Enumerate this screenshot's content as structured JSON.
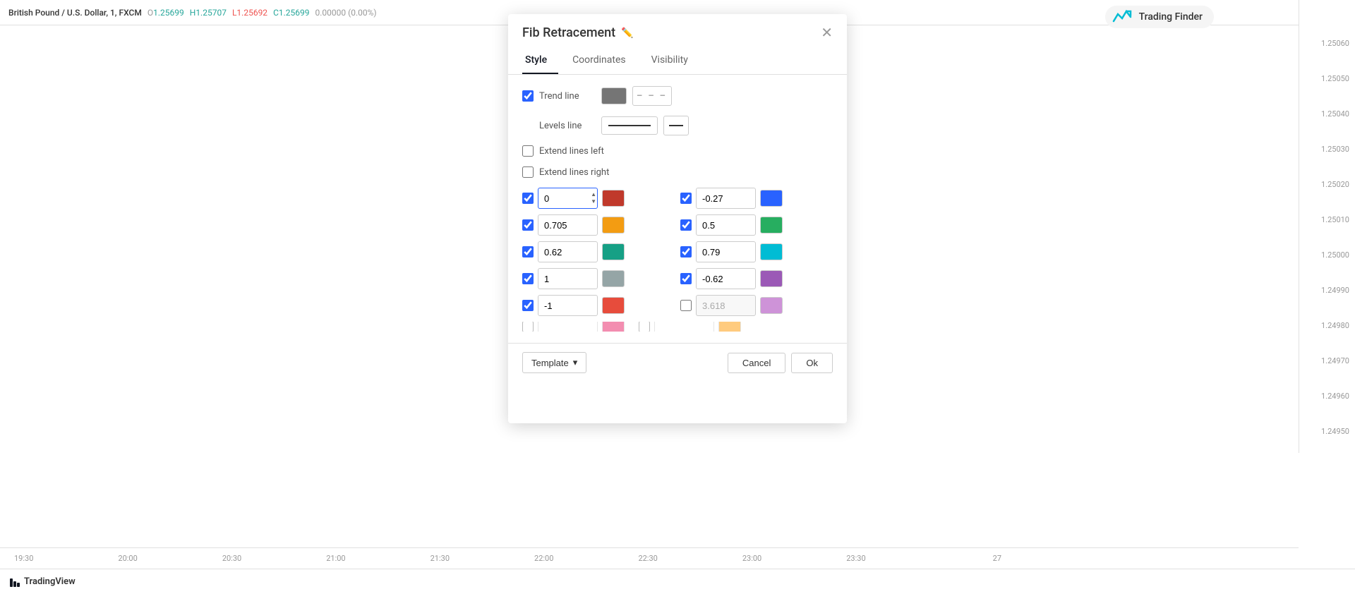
{
  "topbar": {
    "pair": "British Pound / U.S. Dollar, 1, FXCM",
    "o_label": "O",
    "o_value": "1.25699",
    "h_label": "H",
    "h_value": "1.25707",
    "l_label": "L",
    "l_value": "1.25692",
    "c_label": "C",
    "c_value": "1.25699",
    "change": "0.00000 (0.00%)"
  },
  "trading_finder": {
    "text": "Trading Finder"
  },
  "price_axis": {
    "prices": [
      "1.25060",
      "1.25050",
      "1.25040",
      "1.25030",
      "1.25020",
      "1.25010",
      "1.25000",
      "1.24990",
      "1.24980",
      "1.24970",
      "1.24960",
      "1.24950"
    ]
  },
  "time_axis": {
    "labels": [
      "19:30",
      "20:00",
      "20:30",
      "21:00",
      "21:30",
      "22:00",
      "22:30",
      "23:00",
      "23:30",
      "27"
    ]
  },
  "bottom_bar": {
    "brand": "TradingView"
  },
  "dialog": {
    "title": "Fib Retracement",
    "tabs": [
      "Style",
      "Coordinates",
      "Visibility"
    ],
    "active_tab": "Style",
    "trend_line": {
      "label": "Trend line",
      "checked": true,
      "color": "#757575"
    },
    "levels_line": {
      "label": "Levels line"
    },
    "extend_left": {
      "label": "Extend lines left",
      "checked": false
    },
    "extend_right": {
      "label": "Extend lines right",
      "checked": false
    },
    "levels": [
      {
        "checked": true,
        "value": "0",
        "color": "#c0392b",
        "side": "left",
        "active": true
      },
      {
        "checked": true,
        "value": "-0.27",
        "color": "#2962FF",
        "side": "right"
      },
      {
        "checked": true,
        "value": "0.705",
        "color": "#f39c12",
        "side": "left"
      },
      {
        "checked": true,
        "value": "0.5",
        "color": "#27ae60",
        "side": "right"
      },
      {
        "checked": true,
        "value": "0.62",
        "color": "#16a085",
        "side": "left"
      },
      {
        "checked": true,
        "value": "0.79",
        "color": "#00bcd4",
        "side": "right"
      },
      {
        "checked": true,
        "value": "1",
        "color": "#95a5a6",
        "side": "left"
      },
      {
        "checked": true,
        "value": "-0.62",
        "color": "#9b59b6",
        "side": "right"
      },
      {
        "checked": true,
        "value": "-1",
        "color": "#e74c3c",
        "side": "left"
      },
      {
        "checked": false,
        "value": "3.618",
        "color": "#ce93d8",
        "side": "right",
        "disabled": true
      }
    ],
    "footer": {
      "template_label": "Template",
      "cancel_label": "Cancel",
      "ok_label": "Ok"
    }
  }
}
